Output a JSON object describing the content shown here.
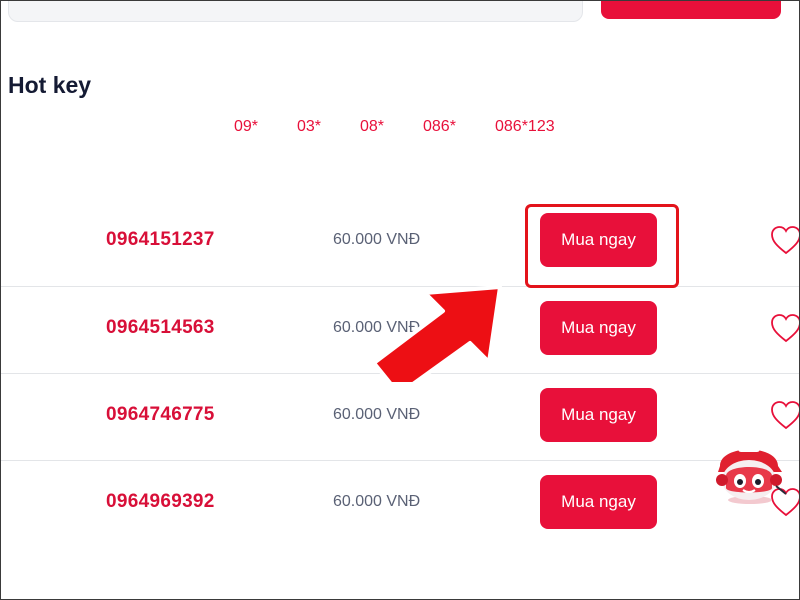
{
  "hot_key": {
    "title": "Hot key",
    "items": [
      "09*",
      "03*",
      "08*",
      "086*",
      "086*123"
    ]
  },
  "listings": [
    {
      "number": "0964151237",
      "price": "60.000 VNĐ",
      "buy_label": "Mua ngay"
    },
    {
      "number": "0964514563",
      "price": "60.000 VNĐ",
      "buy_label": "Mua ngay"
    },
    {
      "number": "0964746775",
      "price": "60.000 VNĐ",
      "buy_label": "Mua ngay"
    },
    {
      "number": "0964969392",
      "price": "60.000 VNĐ",
      "buy_label": "Mua ngay"
    }
  ],
  "icons": {
    "favorite": "heart-outline-icon",
    "annotation_arrow": "red-arrow-icon",
    "chat_assistant": "mascot-robot-icon"
  },
  "colors": {
    "accent": "#e8103a",
    "phone_number": "#d80f38",
    "title": "#141a33",
    "price": "#5a6175",
    "highlight": "#e3131b"
  }
}
